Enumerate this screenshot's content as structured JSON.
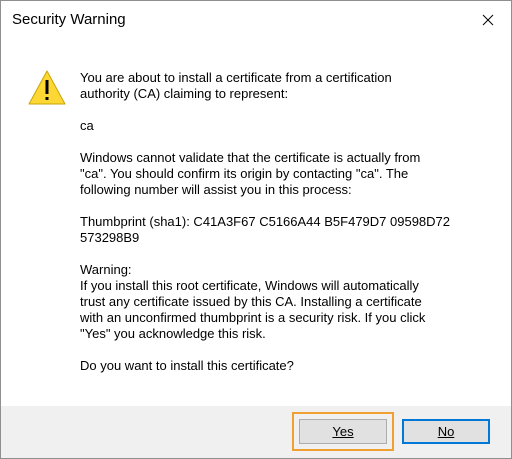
{
  "window": {
    "title": "Security Warning",
    "close_icon": "close-icon"
  },
  "icon": {
    "name": "warning-icon",
    "color": "#fdd835"
  },
  "message": {
    "intro": "You are about to install a certificate from a certification\nauthority (CA) claiming to represent:",
    "subject": "ca",
    "validation": "Windows cannot validate that the certificate is actually from\n\"ca\". You should confirm its origin by contacting \"ca\". The\nfollowing number will assist you in this process:",
    "thumbprint": "Thumbprint (sha1): C41A3F67 C5166A44 B5F479D7 09598D72\n573298B9",
    "warning": "Warning:\nIf you install this root certificate, Windows will automatically\ntrust any certificate issued by this CA. Installing a certificate\nwith an unconfirmed thumbprint is a security risk. If you click\n\"Yes\" you acknowledge this risk.",
    "question": "Do you want to install this certificate?"
  },
  "buttons": {
    "yes_label": "Yes",
    "no_label": "No"
  },
  "colors": {
    "focus_ring": "#f0a030",
    "default_button_border": "#0078d7",
    "footer_background": "#f0f0f0"
  }
}
